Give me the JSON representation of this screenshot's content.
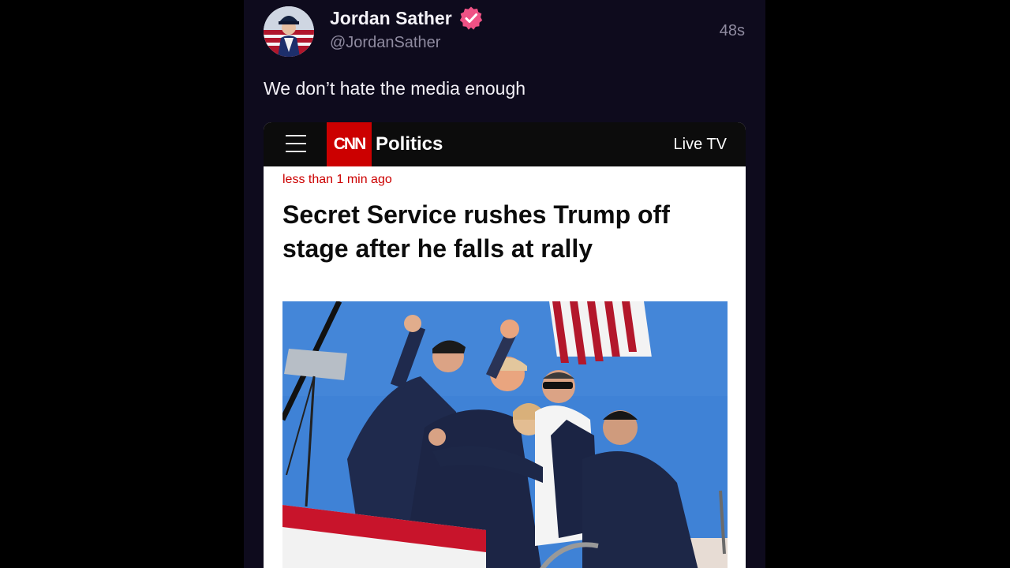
{
  "tweet": {
    "author_name": "Jordan Sather",
    "handle": "@JordanSather",
    "time": "48s",
    "text": "We don’t hate the media enough",
    "avatar_icon": "profile-avatar",
    "verified_icon": "verified-badge-icon",
    "verified_color": "#ef5285"
  },
  "embed": {
    "header": {
      "logo": "CNN",
      "section": "Politics",
      "live_tv": "Live TV",
      "menu_icon": "hamburger-menu-icon",
      "brand_color": "#cc0000",
      "bar_color": "#0c0c0c"
    },
    "article": {
      "time": "less than 1 min ago",
      "headline": "Secret Service rushes Trump off stage after he falls at rally"
    },
    "photo": {
      "subject": "rally-stage-photo",
      "sky_color": "#3f82d6"
    }
  }
}
